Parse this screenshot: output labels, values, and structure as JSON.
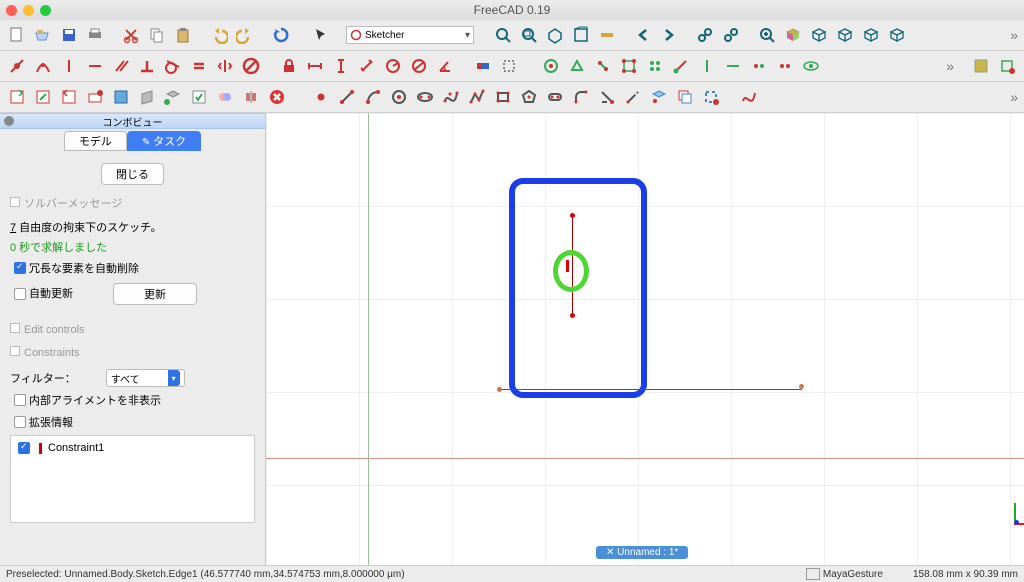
{
  "window": {
    "title": "FreeCAD 0.19"
  },
  "menu": {
    "workbench": "Sketcher"
  },
  "panel": {
    "title": "コンボビュー",
    "tabs": {
      "model": "モデル",
      "task": "タスク"
    },
    "close": "閉じる",
    "solver_caption": "ソルバーメッセージ",
    "dof_num": "7",
    "dof_text": " 自由度の拘束下のスケッチ。",
    "solve_time": "0 秒で求解しました",
    "autoremove": "冗長な要素を自動削除",
    "autoupdate": "自動更新",
    "update_btn": "更新",
    "edit_controls": "Edit controls",
    "constraints": "Constraints",
    "filter_label": "フィルター：",
    "filter_value": "すべて",
    "hide_internal": "内部アライメントを非表示",
    "extended": "拡張情報",
    "constraint_item": "Constraint1"
  },
  "doc_tab": "Unnamed : 1*",
  "status": {
    "preselect": "Preselected: Unnamed.Body.Sketch.Edge1 (46.577740 mm,34.574753 mm,8.000000 μm)",
    "nav": "MayaGesture",
    "dim": "158.08 mm x 90.39 mm"
  }
}
